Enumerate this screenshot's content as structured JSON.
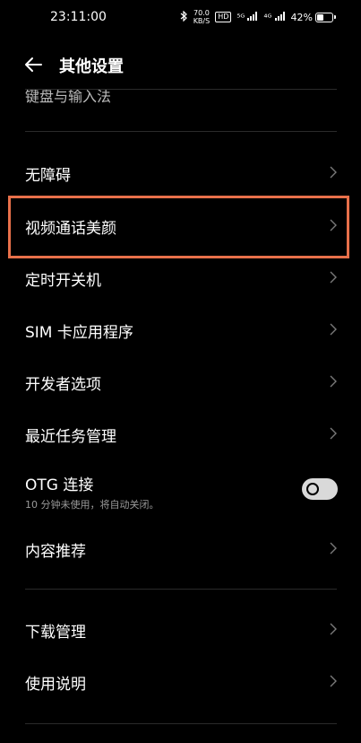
{
  "status_bar": {
    "time": "23:11:00",
    "net_speed_value": "70.0",
    "net_speed_unit": "KB/S",
    "hd_badge": "HD",
    "signal_1": "⁵ᴳ",
    "signal_2": "⁴ᴳ",
    "battery_percent": "42%",
    "battery_level": 0.42
  },
  "header": {
    "title": "其他设置"
  },
  "partial_item": {
    "label": "键盘与输入法"
  },
  "items": [
    {
      "label": "无障碍"
    },
    {
      "label": "视频通话美颜"
    },
    {
      "label": "定时开关机"
    },
    {
      "label": "SIM 卡应用程序"
    },
    {
      "label": "开发者选项"
    },
    {
      "label": "最近任务管理"
    },
    {
      "label": "OTG 连接",
      "sub": "10 分钟未使用，将自动关闭。",
      "toggle_on": false
    },
    {
      "label": "内容推荐"
    },
    {
      "label": "下载管理"
    },
    {
      "label": "使用说明"
    }
  ],
  "colors": {
    "highlight": "#e8704a",
    "background": "#000000"
  }
}
